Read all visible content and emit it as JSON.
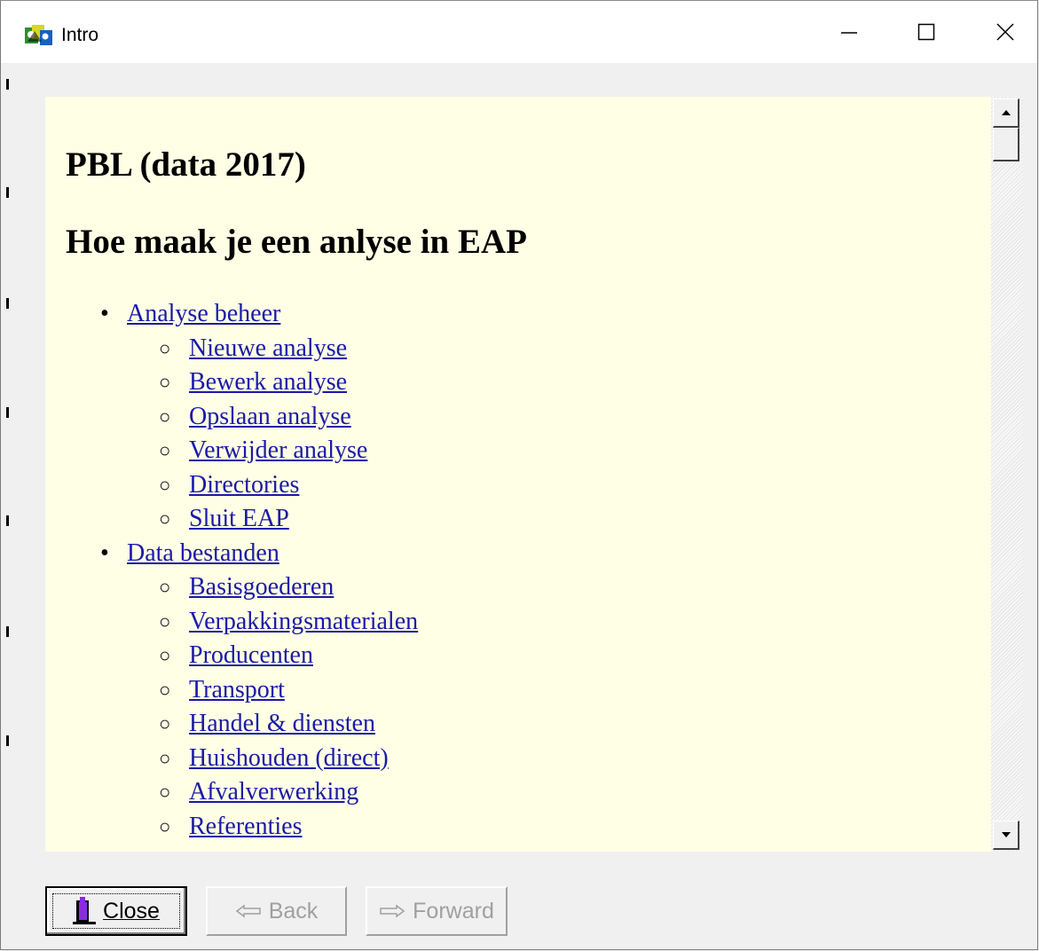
{
  "window": {
    "title": "Intro",
    "controls": {
      "minimize": "minimize",
      "maximize": "maximize",
      "close": "close"
    }
  },
  "content": {
    "heading1": "PBL (data 2017)",
    "heading2": "Hoe maak je een anlyse in EAP",
    "toc": [
      {
        "level": 1,
        "label": "Analyse beheer"
      },
      {
        "level": 2,
        "label": "Nieuwe analyse"
      },
      {
        "level": 2,
        "label": "Bewerk analyse"
      },
      {
        "level": 2,
        "label": "Opslaan analyse"
      },
      {
        "level": 2,
        "label": "Verwijder analyse"
      },
      {
        "level": 2,
        "label": "Directories"
      },
      {
        "level": 2,
        "label": "Sluit EAP"
      },
      {
        "level": 1,
        "label": "Data bestanden"
      },
      {
        "level": 2,
        "label": "Basisgoederen"
      },
      {
        "level": 2,
        "label": "Verpakkingsmaterialen"
      },
      {
        "level": 2,
        "label": "Producenten"
      },
      {
        "level": 2,
        "label": "Transport"
      },
      {
        "level": 2,
        "label": "Handel & diensten"
      },
      {
        "level": 2,
        "label": "Huishouden (direct)"
      },
      {
        "level": 2,
        "label": "Afvalverwerking"
      },
      {
        "level": 2,
        "label": "Referenties"
      }
    ]
  },
  "buttons": {
    "close": {
      "label": "Close",
      "enabled": true
    },
    "back": {
      "label": "Back",
      "enabled": false
    },
    "forward": {
      "label": "Forward",
      "enabled": false
    }
  },
  "colors": {
    "content_bg": "#ffffe6",
    "link": "#1a1aa6",
    "disabled_text": "#a0a0a0"
  }
}
